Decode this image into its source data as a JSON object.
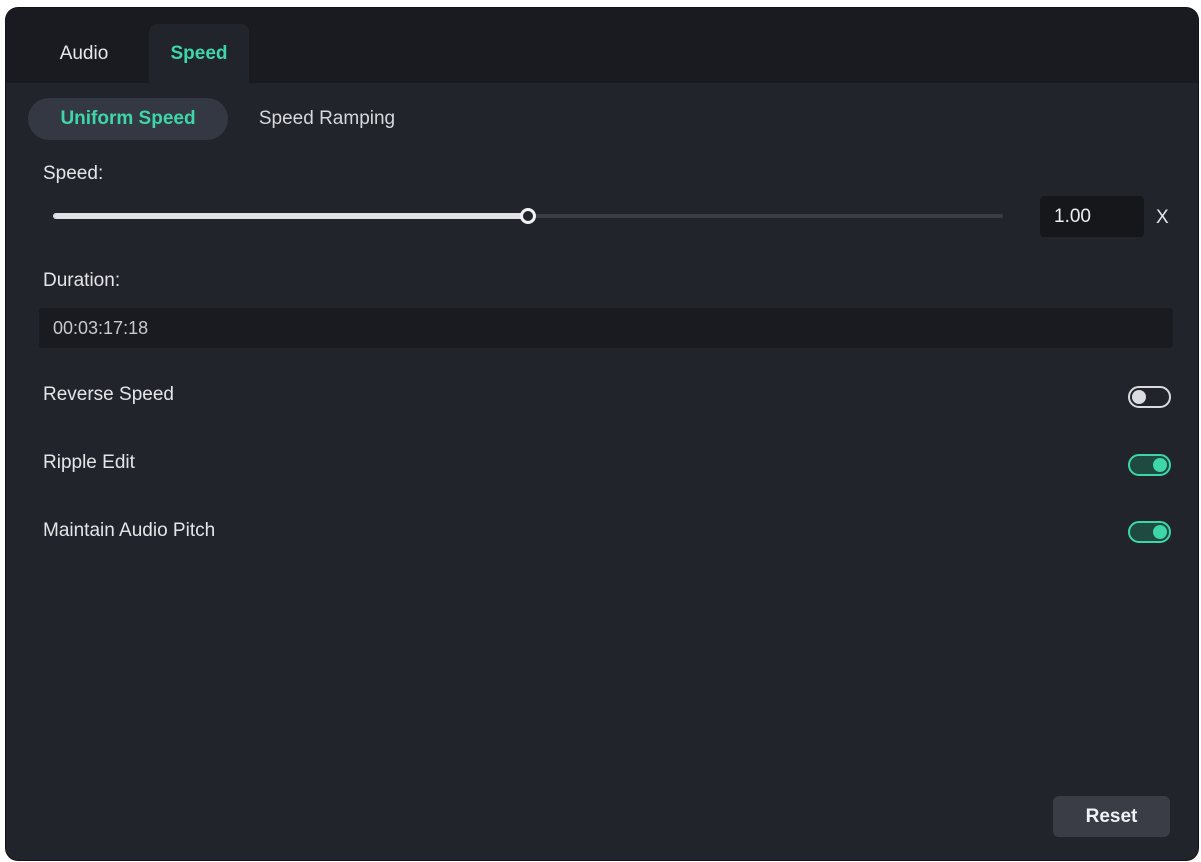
{
  "tabs": [
    {
      "label": "Audio",
      "active": false
    },
    {
      "label": "Speed",
      "active": true
    }
  ],
  "subtabs": [
    {
      "label": "Uniform Speed",
      "active": true
    },
    {
      "label": "Speed Ramping",
      "active": false
    }
  ],
  "speed": {
    "label": "Speed:",
    "value": "1.00",
    "unit": "X",
    "slider_fraction": 0.5
  },
  "duration": {
    "label": "Duration:",
    "value": "00:03:17:18"
  },
  "toggles": [
    {
      "label": "Reverse Speed",
      "on": false
    },
    {
      "label": "Ripple Edit",
      "on": true
    },
    {
      "label": "Maintain Audio Pitch",
      "on": true
    }
  ],
  "reset_label": "Reset",
  "colors": {
    "accent": "#3ed6a8",
    "panel_bg": "#22242b",
    "tabbar_bg": "#191b20"
  }
}
